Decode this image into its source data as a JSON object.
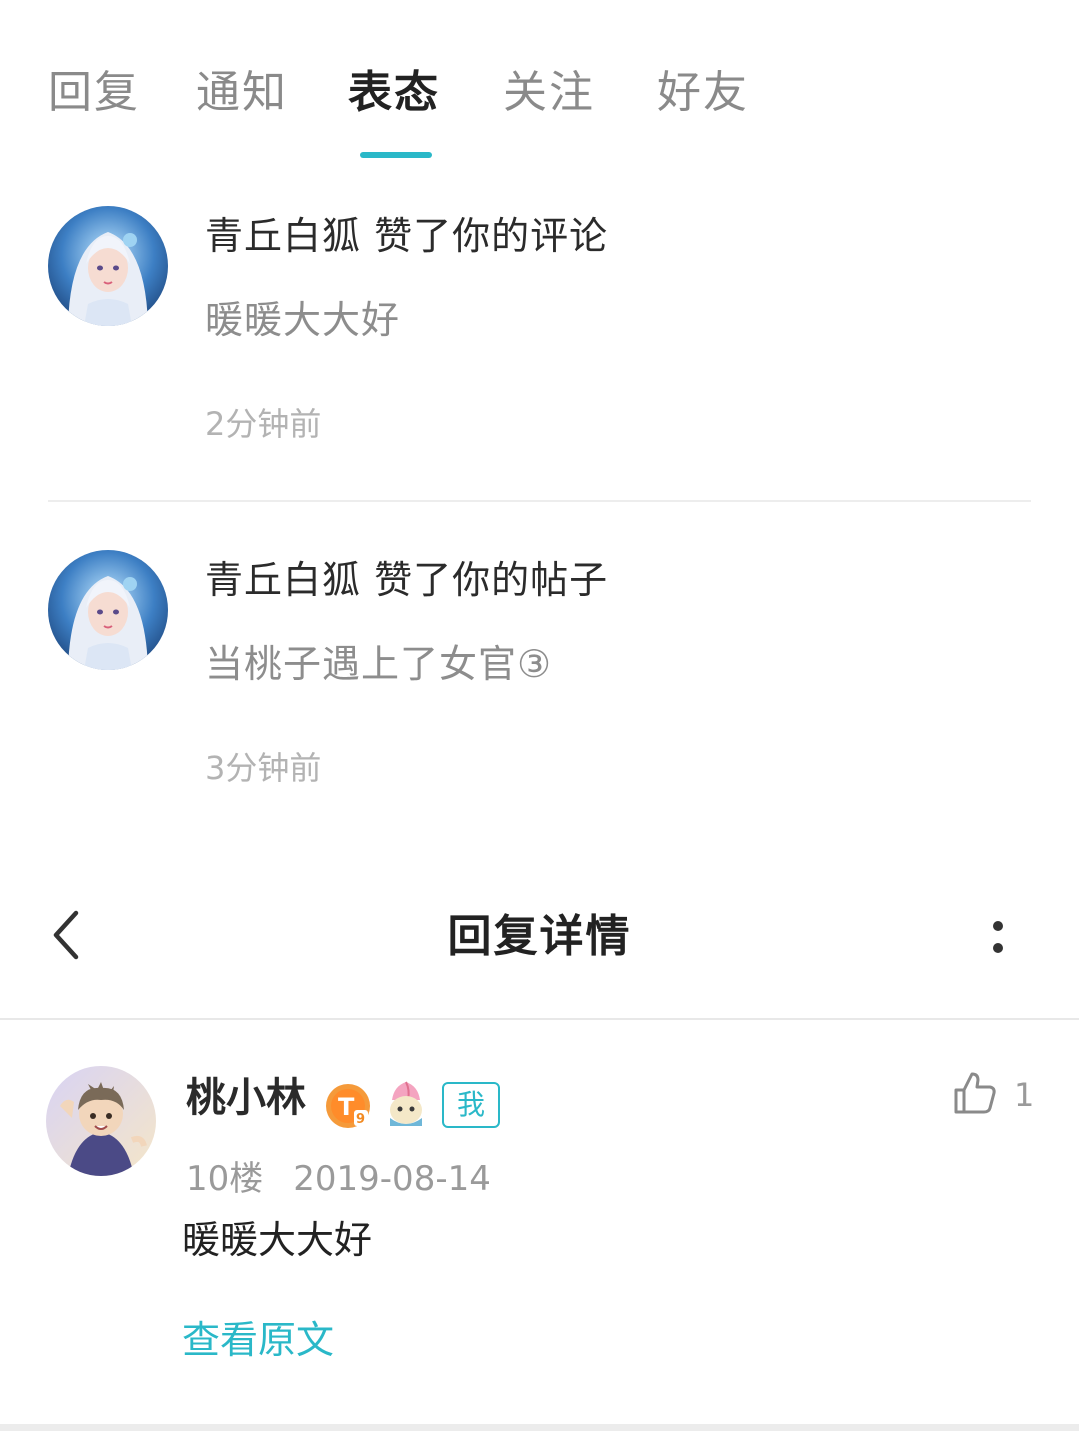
{
  "tabs": [
    {
      "label": "回复",
      "active": false
    },
    {
      "label": "通知",
      "active": false
    },
    {
      "label": "表态",
      "active": true
    },
    {
      "label": "关注",
      "active": false
    },
    {
      "label": "好友",
      "active": false
    }
  ],
  "notifications": [
    {
      "title": "青丘白狐 赞了你的评论",
      "body": "暖暖大大好",
      "time": "2分钟前"
    },
    {
      "title": "青丘白狐 赞了你的帖子",
      "body": "当桃子遇上了女官③",
      "time": "3分钟前"
    }
  ],
  "detail": {
    "title": "回复详情",
    "reply": {
      "username": "桃小林",
      "me_badge": "我",
      "likes": "1",
      "floor": "10楼",
      "date": "2019-08-14",
      "content": "暖暖大大好",
      "view_original": "查看原文"
    }
  },
  "colors": {
    "accent": "#2ab8c8",
    "text_primary": "#222222",
    "text_secondary": "#8d8d8d",
    "text_muted": "#b3b3b3",
    "divider": "#ededed"
  },
  "icons": {
    "back": "chevron-left-icon",
    "more": "vertical-dots-icon",
    "like": "thumbs-up-icon"
  }
}
